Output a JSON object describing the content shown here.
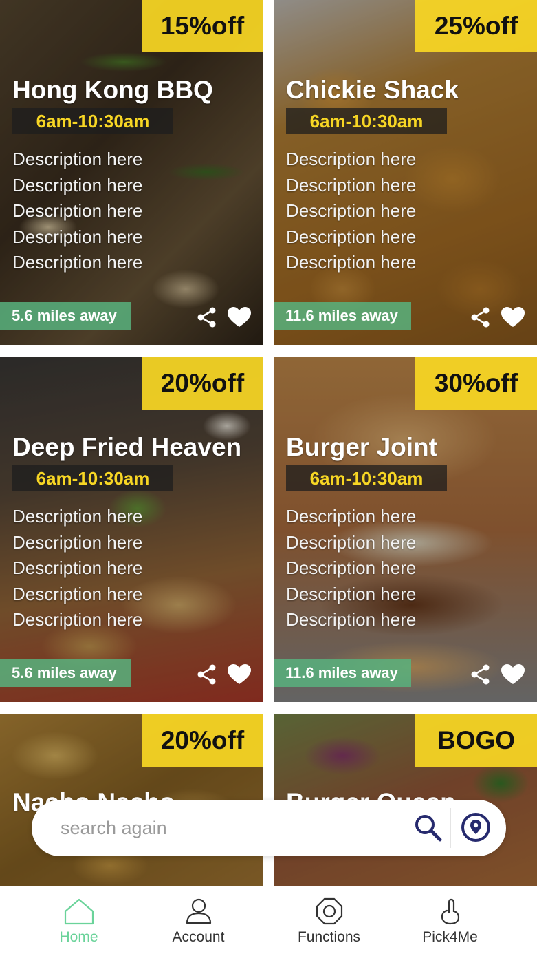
{
  "colors": {
    "deal_badge": "#f7d624",
    "hours_text": "#f7d624",
    "distance_badge": "#58b27e",
    "active_tab": "#6ad39a",
    "search_icon": "#262a6e"
  },
  "cards": [
    {
      "deal": "15%off",
      "name": "Hong Kong BBQ",
      "hours": "6am-10:30am",
      "description": [
        "Description here",
        "Description here",
        "Description here",
        "Description here",
        "Description here"
      ],
      "distance": "5.6 miles away"
    },
    {
      "deal": "25%off",
      "name": "Chickie Shack",
      "hours": "6am-10:30am",
      "description": [
        "Description here",
        "Description here",
        "Description here",
        "Description here",
        "Description here"
      ],
      "distance": "11.6 miles away"
    },
    {
      "deal": "20%off",
      "name": "Deep Fried Heaven",
      "hours": "6am-10:30am",
      "description": [
        "Description here",
        "Description here",
        "Description here",
        "Description here",
        "Description here"
      ],
      "distance": "5.6 miles away"
    },
    {
      "deal": "30%off",
      "name": "Burger Joint",
      "hours": "6am-10:30am",
      "description": [
        "Description here",
        "Description here",
        "Description here",
        "Description here",
        "Description here"
      ],
      "distance": "11.6 miles away"
    },
    {
      "deal": "20%off",
      "name": "Nacho Nacho"
    },
    {
      "deal": "BOGO",
      "name": "Burger Queen"
    }
  ],
  "search": {
    "placeholder": "search again"
  },
  "icons": {
    "search": "search-icon",
    "location": "location-pin-icon",
    "share": "share-icon",
    "heart": "heart-icon"
  },
  "tabs": [
    {
      "label": "Home",
      "icon": "home-icon",
      "active": true
    },
    {
      "label": "Account",
      "icon": "user-icon",
      "active": false
    },
    {
      "label": "Functions",
      "icon": "octagon-icon",
      "active": false
    },
    {
      "label": "Pick4Me",
      "icon": "hand-icon",
      "active": false
    }
  ]
}
